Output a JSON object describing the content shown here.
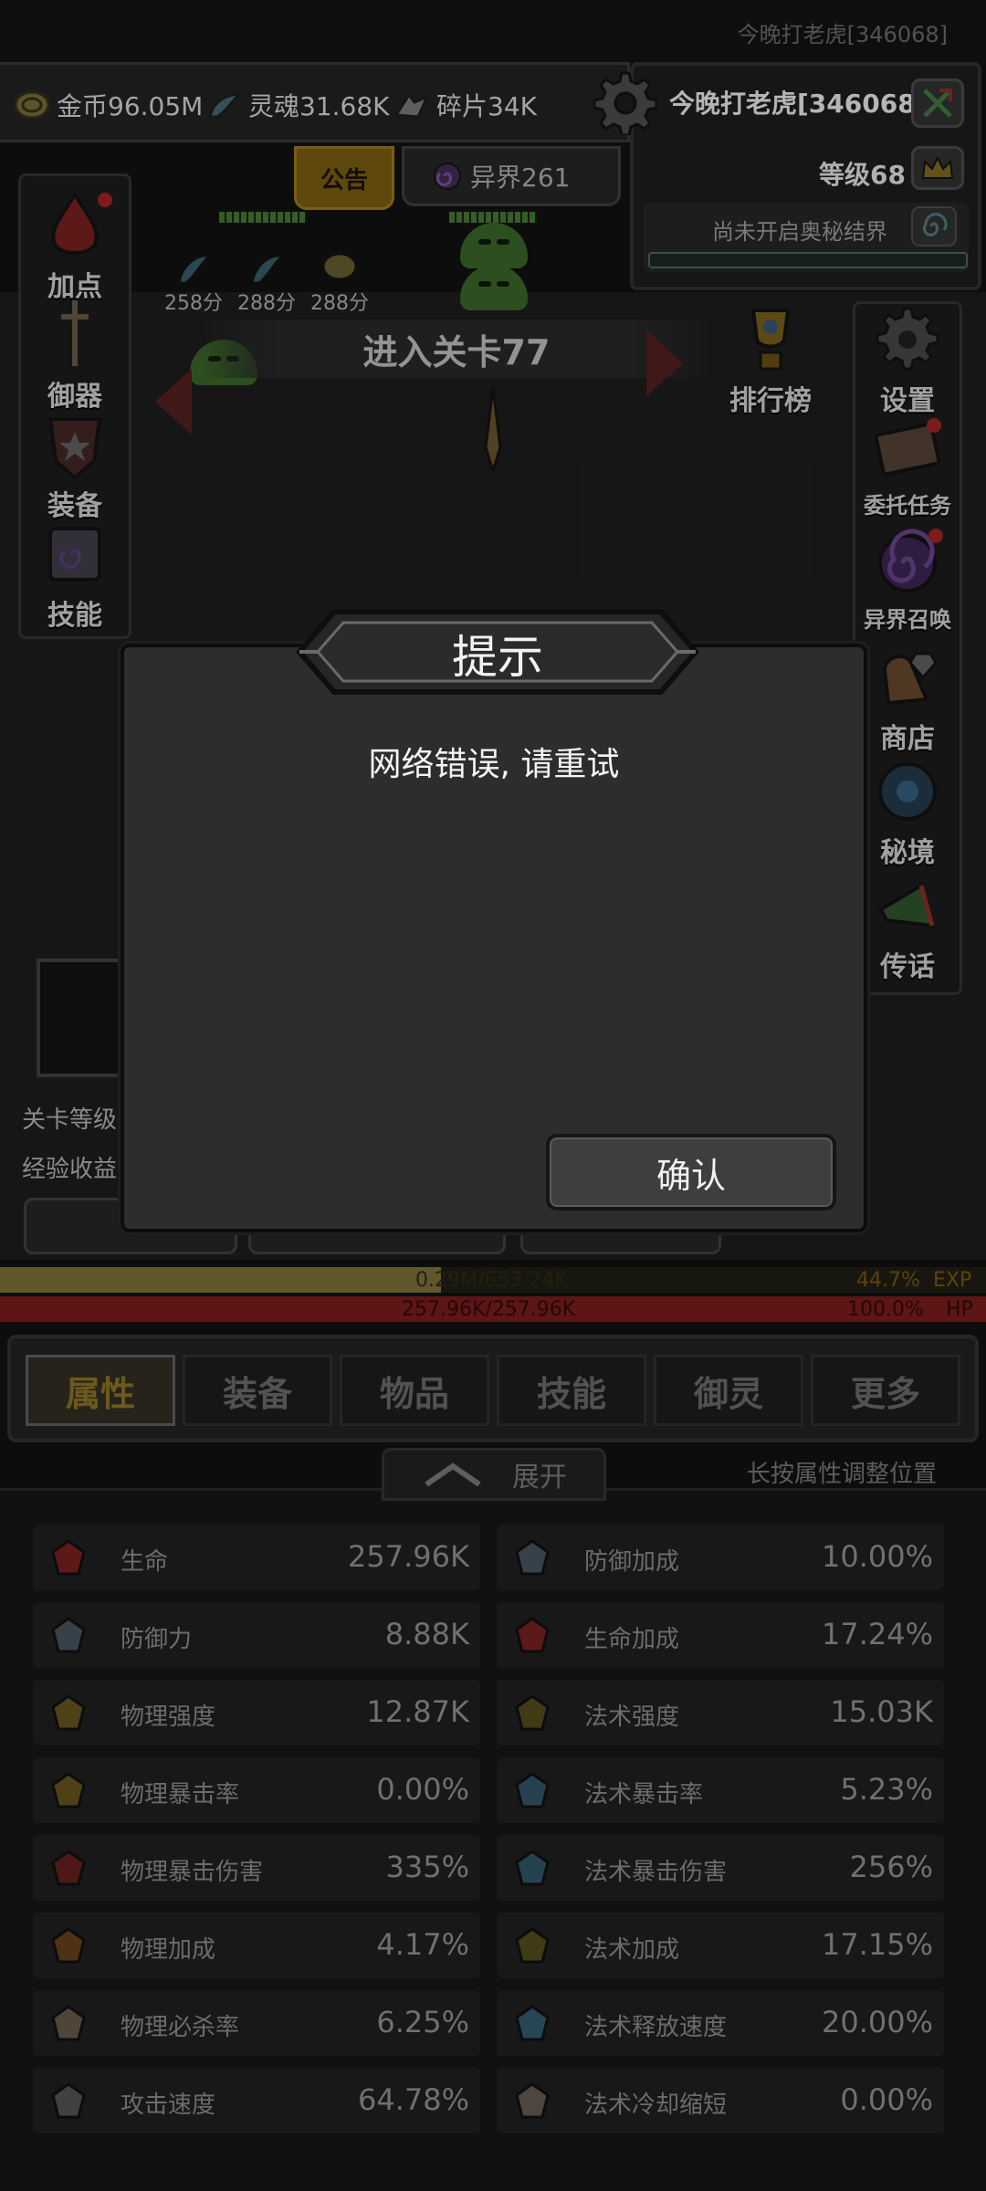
{
  "player": {
    "top_name": "今晚打老虎[346068]",
    "name": "今晚打老虎[346068]",
    "level": "等级68",
    "secret_realm": "尚未开启奥秘结界"
  },
  "resources": [
    {
      "label": "金币96.05M",
      "icon": "coin-icon"
    },
    {
      "label": "灵魂31.68K",
      "icon": "soul-icon"
    },
    {
      "label": "碎片34K",
      "icon": "shard-icon"
    }
  ],
  "tabs_top": {
    "notice": "公告",
    "otherworld": "异界261"
  },
  "left_menu": [
    {
      "label": "加点",
      "icon": "blood-drop-icon"
    },
    {
      "label": "御器",
      "icon": "sword-icon"
    },
    {
      "label": "装备",
      "icon": "armor-icon"
    },
    {
      "label": "技能",
      "icon": "scroll-icon"
    }
  ],
  "right_menu": [
    {
      "label": "排行榜",
      "icon": "trophy-icon"
    },
    {
      "label": "设置",
      "icon": "gear-icon"
    },
    {
      "label": "委托任务",
      "icon": "quest-icon"
    },
    {
      "label": "异界召唤",
      "icon": "portal-icon"
    },
    {
      "label": "商店",
      "icon": "shop-icon"
    },
    {
      "label": "秘境",
      "icon": "secret-icon"
    },
    {
      "label": "传话",
      "icon": "horn-icon"
    }
  ],
  "battle": {
    "stage_title": "进入关卡77",
    "drops": [
      "258分",
      "288分",
      "288分"
    ],
    "stage_level_label": "关卡等级",
    "exp_gain_label": "经验收益"
  },
  "bars": {
    "exp": {
      "text": "0.29M/653.24K",
      "percent": "44.7%",
      "tag": "EXP",
      "fill": 0.447
    },
    "hp": {
      "text": "257.96K/257.96K",
      "percent": "100.0%",
      "tag": "HP",
      "fill": 1.0
    }
  },
  "tabs": [
    "属性",
    "装备",
    "物品",
    "技能",
    "御灵",
    "更多"
  ],
  "expand_label": "展开",
  "hint": "长按属性调整位置",
  "stats": [
    {
      "name": "生命",
      "value": "257.96K",
      "icon": "heart-icon"
    },
    {
      "name": "防御加成",
      "value": "10.00%",
      "icon": "shield-plus-icon"
    },
    {
      "name": "防御力",
      "value": "8.88K",
      "icon": "shield-icon"
    },
    {
      "name": "生命加成",
      "value": "17.24%",
      "icon": "heart-plus-icon"
    },
    {
      "name": "物理强度",
      "value": "12.87K",
      "icon": "axe-icon"
    },
    {
      "name": "法术强度",
      "value": "15.03K",
      "icon": "magic-icon"
    },
    {
      "name": "物理暴击率",
      "value": "0.00%",
      "icon": "crit-icon"
    },
    {
      "name": "法术暴击率",
      "value": "5.23%",
      "icon": "magic-crit-icon"
    },
    {
      "name": "物理暴击伤害",
      "value": "335%",
      "icon": "crit-damage-icon"
    },
    {
      "name": "法术暴击伤害",
      "value": "256%",
      "icon": "magic-crit-damage-icon"
    },
    {
      "name": "物理加成",
      "value": "4.17%",
      "icon": "sword-plus-icon"
    },
    {
      "name": "法术加成",
      "value": "17.15%",
      "icon": "magic-plus-icon"
    },
    {
      "name": "物理必杀率",
      "value": "6.25%",
      "icon": "skull-icon"
    },
    {
      "name": "法术释放速度",
      "value": "20.00%",
      "icon": "mushroom-icon"
    },
    {
      "name": "攻击速度",
      "value": "64.78%",
      "icon": "speed-icon"
    },
    {
      "name": "法术冷却缩短",
      "value": "0.00%",
      "icon": "hourglass-icon"
    }
  ],
  "modal": {
    "title": "提示",
    "message": "网络错误, 请重试",
    "confirm": "确认"
  }
}
